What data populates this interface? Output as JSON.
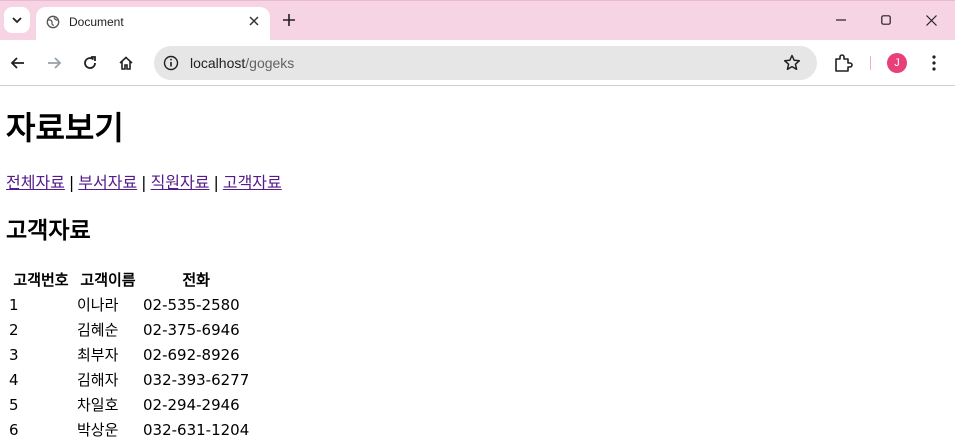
{
  "browser": {
    "tab_title": "Document",
    "url_host": "localhost",
    "url_path": "/gogeks",
    "profile_initial": "J",
    "colors": {
      "tabstrip": "#f7d4e3",
      "avatar": "#e8407a",
      "visited_link": "#551a8b"
    },
    "icons": [
      "tab-search-icon",
      "globe-icon",
      "close-icon",
      "plus-icon",
      "minimize-icon",
      "maximize-icon",
      "window-close-icon",
      "back-arrow-icon",
      "forward-arrow-icon",
      "reload-icon",
      "home-icon",
      "site-info-icon",
      "star-icon",
      "puzzle-icon",
      "kebab-menu-icon"
    ]
  },
  "page": {
    "title": "자료보기",
    "nav": [
      {
        "label": "전체자료"
      },
      {
        "label": "부서자료"
      },
      {
        "label": "직원자료"
      },
      {
        "label": "고객자료"
      }
    ],
    "separator": "|",
    "section_title": "고객자료",
    "table": {
      "headers": [
        "고객번호",
        "고객이름",
        "전화"
      ],
      "rows": [
        [
          "1",
          "이나라",
          "02-535-2580"
        ],
        [
          "2",
          "김혜순",
          "02-375-6946"
        ],
        [
          "3",
          "최부자",
          "02-692-8926"
        ],
        [
          "4",
          "김해자",
          "032-393-6277"
        ],
        [
          "5",
          "차일호",
          "02-294-2946"
        ],
        [
          "6",
          "박상운",
          "032-631-1204"
        ]
      ]
    }
  }
}
